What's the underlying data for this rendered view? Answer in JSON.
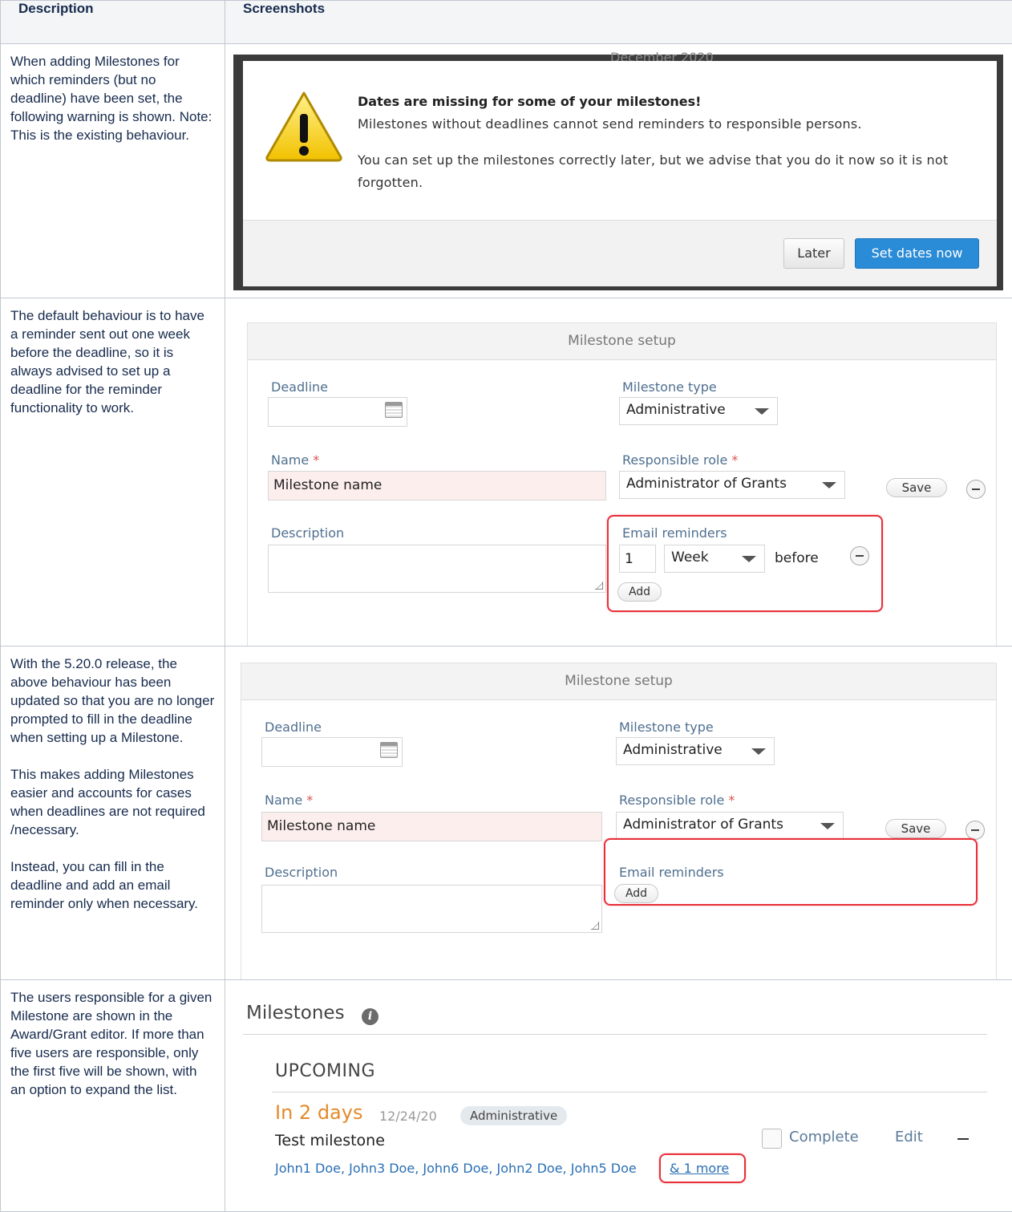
{
  "table": {
    "header_description": "Description",
    "header_screenshots": "Screenshots"
  },
  "rows": [
    {
      "description": [
        "When adding Milestones for which reminders (but no deadline) have been set, the following warning is shown. Note: This is the existing behaviour."
      ]
    },
    {
      "description": [
        "The default behaviour is to have a reminder sent out one week before the deadline, so it is always advised to set up a deadline for the reminder functionality to work."
      ]
    },
    {
      "description": [
        "With the 5.20.0 release, the above behaviour has been updated so that you are no longer prompted to fill in the deadline when setting up a Milestone.",
        "This makes adding Milestones easier and accounts for cases when deadlines are not required /necessary.",
        "Instead, you can fill in the deadline and add an email reminder only when necessary."
      ]
    },
    {
      "description": [
        "The users responsible for a given Milestone are shown in the Award/Grant editor. If more than five users are responsible, only the first five will be shown, with an option to expand the list."
      ]
    }
  ],
  "modal": {
    "background_text": "December 2020",
    "title": "Dates are missing for some of your milestones!",
    "line1": "Milestones without deadlines cannot send reminders to responsible persons.",
    "line2": "You can set up the milestones correctly later, but we advise that you do it now so it is not forgotten.",
    "later_label": "Later",
    "set_dates_label": "Set dates now",
    "icon": "warning-icon"
  },
  "setup1": {
    "header": "Milestone setup",
    "deadline_label": "Deadline",
    "deadline_value": "",
    "type_label": "Milestone type",
    "type_value": "Administrative",
    "name_label": "Name",
    "name_value": "Milestone name",
    "role_label": "Responsible role",
    "role_value": "Administrator of Grants",
    "save_label": "Save",
    "description_label": "Description",
    "email_label": "Email reminders",
    "reminder_amount": "1",
    "reminder_unit": "Week",
    "reminder_before": "before",
    "add_label": "Add",
    "required_mark": "*"
  },
  "setup2": {
    "header": "Milestone setup",
    "deadline_label": "Deadline",
    "type_label": "Milestone type",
    "type_value": "Administrative",
    "name_label": "Name",
    "name_value": "Milestone name",
    "role_label": "Responsible role",
    "role_value": "Administrator of Grants",
    "save_label": "Save",
    "description_label": "Description",
    "email_label": "Email reminders",
    "add_label": "Add",
    "required_mark": "*"
  },
  "milestones": {
    "title": "Milestones",
    "info_icon": "i",
    "section": "UPCOMING",
    "due": "In 2 days",
    "date": "12/24/20",
    "badge": "Administrative",
    "name": "Test milestone",
    "complete_label": "Complete",
    "edit_label": "Edit",
    "people": "John1 Doe, John3 Doe, John6 Doe, John2 Doe, John5 Doe",
    "more_label": "& 1 more"
  },
  "colors": {
    "accent_blue": "#2a8bd6",
    "highlight_red": "#e8303a",
    "due_orange": "#e48a2a"
  }
}
